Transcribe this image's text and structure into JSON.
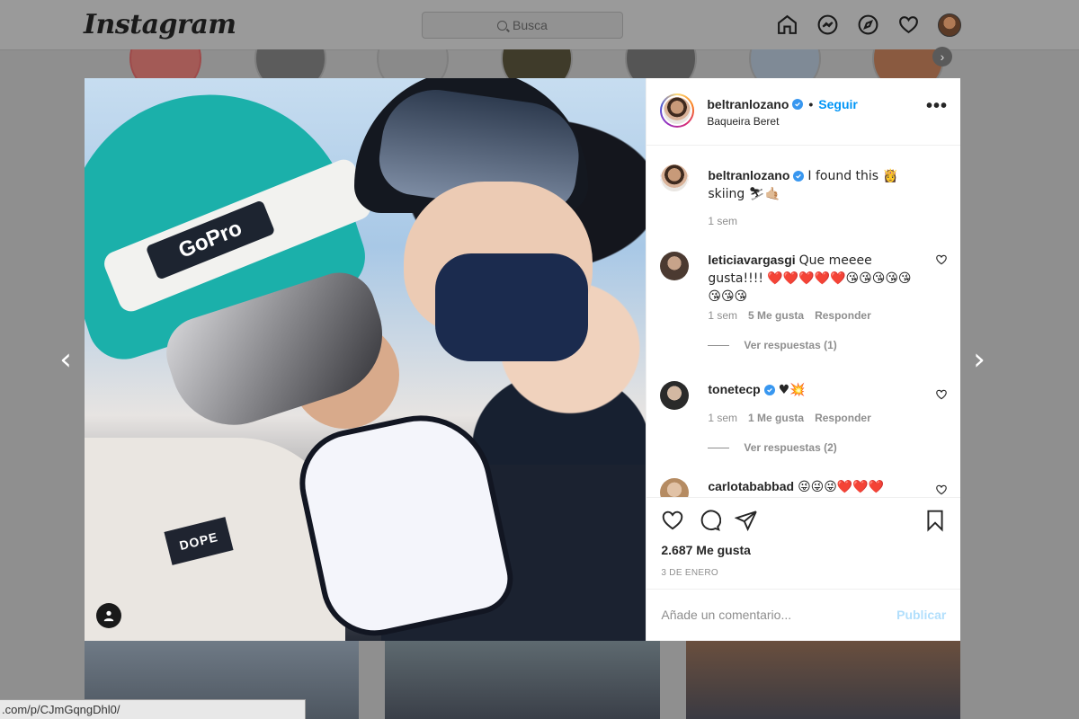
{
  "app": {
    "logo": "Instagram",
    "search_placeholder": "Busca",
    "nav_icons": [
      "home-icon",
      "messenger-icon",
      "explore-icon",
      "heart-icon",
      "profile-avatar"
    ]
  },
  "status_bar_url": ".com/p/CJmGqngDhl0/",
  "post": {
    "author": "beltranlozano",
    "follow_label": "Seguir",
    "separator": "•",
    "location": "Baqueira Beret",
    "more_label": "•••",
    "caption": {
      "user": "beltranlozano",
      "text": "I found this 👸 skiing ⛷🤙🏼",
      "time": "1 sem"
    },
    "comments": [
      {
        "user": "leticiavargasgi",
        "text": "Que meeee gusta!!!! ❤️❤️❤️❤️❤️😘😘😘😘😘😘😘😘",
        "time": "1 sem",
        "likes": "5 Me gusta",
        "reply_label": "Responder",
        "view_replies": "Ver respuestas (1)"
      },
      {
        "user": "tonetecp",
        "text": "♥💥",
        "time": "1 sem",
        "likes": "1 Me gusta",
        "reply_label": "Responder",
        "view_replies": "Ver respuestas (2)"
      },
      {
        "user": "carlotababbad",
        "text": "😜😜😜❤️❤️❤️"
      }
    ],
    "likes_count": "2.687 Me gusta",
    "date": "3 DE ENERO",
    "comment_placeholder": "Añade un comentario...",
    "publish_label": "Publicar",
    "photo_text": {
      "helmet_brand": "GoPro",
      "jacket_brand": "DOPE"
    }
  },
  "colors": {
    "accent": "#0095f6",
    "verified": "#3897f0",
    "muted": "#8e8e8e",
    "publish_disabled": "#b2dffc"
  }
}
